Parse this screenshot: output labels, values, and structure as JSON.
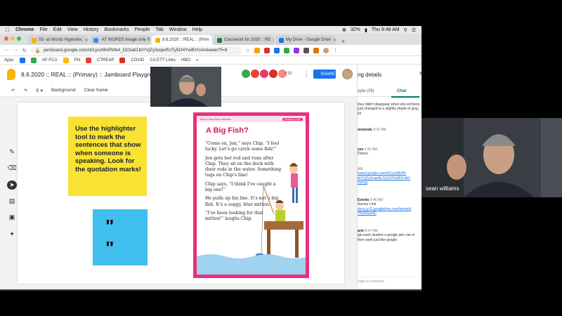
{
  "menubar": {
    "items": [
      "Chrome",
      "File",
      "Edit",
      "View",
      "History",
      "Bookmarks",
      "People",
      "Tab",
      "Window",
      "Help"
    ],
    "battery": "32%",
    "clock": "Thu 9:48 AM"
  },
  "tabs": [
    {
      "label": "S3 -at Words Hyperdoc",
      "favicon_color": "#f4b400"
    },
    {
      "label": "-AT WORDS Image only S",
      "favicon_color": "#4285f4"
    },
    {
      "label": "8.6.2020 :: REAL :: (Prim",
      "favicon_color": "#f6b400"
    },
    {
      "label": "Classwork for 2020 :: RE",
      "favicon_color": "#188038"
    },
    {
      "label": "My Drive - Google Drive",
      "favicon_color": "#1a73e8"
    }
  ],
  "address": {
    "url": "jamboard.google.com/d/1ycxMnPtrtk4_DCkall1tbYVjZy3oqwfIUTy5O4YwBVUA/viewer?f=8"
  },
  "bookmarks": [
    "Apps",
    "AF-FCU",
    "PN",
    "CTREAP",
    "COVID",
    "CA ETT Links",
    "HBO"
  ],
  "jamboard": {
    "title": "8.6.2020 :: REAL :: (Primary) :: Jamboard Playground",
    "collaborators_more": "+19",
    "share_label": "SHARE",
    "toolbar": {
      "background_label": "Background",
      "clear_frame_label": "Clear frame"
    }
  },
  "sticky_yellow": {
    "text": "Use the highlighter tool to mark the sentences that show when someone is speaking. Look for the quotation marks!"
  },
  "sticky_blue": {
    "text": "\" \""
  },
  "story": {
    "header_left": "Topic & Story Gets a Number",
    "header_tag": "Reading Guide",
    "title": "A Big Fish?",
    "paragraphs": [
      "“Come on, Jen,” says Chip. “I feel lucky. Let’s go catch some fish!”",
      "Jen gets her rod and runs after Chip. They sit on the dock with their rods in the water. Something tugs on Chip’s line!",
      "Chip says, “I think I’ve caught a big one!”",
      "He pulls up his line. It’s not a big fish. It’s a soggy, blue mitten!",
      "“I’ve been looking for that mitten!” laughs Chip."
    ]
  },
  "video": {
    "participant_name": "sean williams"
  },
  "chat": {
    "title": "ng details",
    "people_tab": "ople (39)",
    "chat_tab": "Chat",
    "messages": [
      {
        "name": "",
        "time": "",
        "text": "they didn't disappear when she ed them, just changed to a slightly shade of gray, lol"
      },
      {
        "name": "mmonds",
        "time": "9:32 AM",
        "text": ""
      },
      {
        "name": "yes",
        "time": "9:32 AM",
        "text": "Donno"
      },
      {
        "name": "",
        "time": "AM",
        "text": "",
        "link": "board.google.com/d/1ycxMnPtr tbYVjZy3oqwfIUTy5O4YwBVUA/v haring"
      },
      {
        "name": "Events",
        "time": "9:46 AM",
        "text": "Survey Link",
        "link": "docs.ty11.googleform.com/forms/d 7HzRGsmD"
      },
      {
        "name": "aris",
        "time": "9:47 AM",
        "text": "ign each student a google jam can in their work just like google"
      }
    ],
    "input_placeholder": "sage to everyone"
  },
  "colors": {
    "jam_yellow": "#f6b400",
    "share_blue": "#1a73e8",
    "sticky_yellow": "#f9e234",
    "sticky_blue": "#3fc0ee",
    "story_pink": "#e8317a",
    "chat_teal": "#00796b"
  }
}
